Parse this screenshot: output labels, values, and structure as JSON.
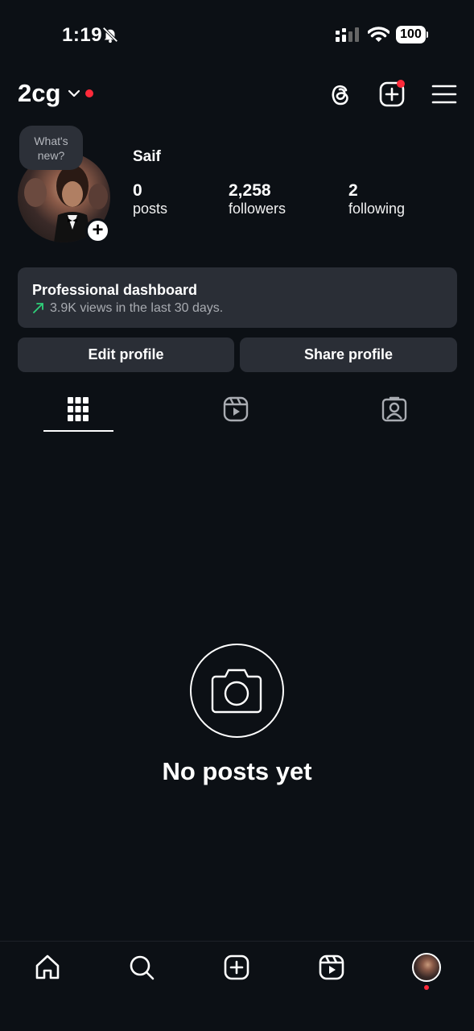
{
  "status": {
    "time": "1:19",
    "battery": "100"
  },
  "header": {
    "username": "2cg"
  },
  "bubble": {
    "line1": "What's",
    "line2": "new?"
  },
  "profile": {
    "name": "Saif",
    "stats": [
      {
        "num": "0",
        "label": "posts"
      },
      {
        "num": "2,258",
        "label": "followers"
      },
      {
        "num": "2",
        "label": "following"
      }
    ]
  },
  "dashboard": {
    "title": "Professional dashboard",
    "subtitle": "3.9K views in the last 30 days."
  },
  "buttons": {
    "edit": "Edit profile",
    "share": "Share profile"
  },
  "empty": {
    "text": "No posts yet"
  },
  "colors": {
    "background": "#0c1015",
    "card": "#2a2e36",
    "accent_red": "#ff2a3a",
    "trend_green": "#2fd07a"
  },
  "icons": {
    "header": [
      "threads-icon",
      "create-post-icon",
      "menu-icon"
    ],
    "tabs": [
      "grid-icon",
      "reels-icon",
      "tagged-icon"
    ],
    "nav": [
      "home-icon",
      "search-icon",
      "create-icon",
      "reels-icon",
      "profile-avatar"
    ]
  }
}
